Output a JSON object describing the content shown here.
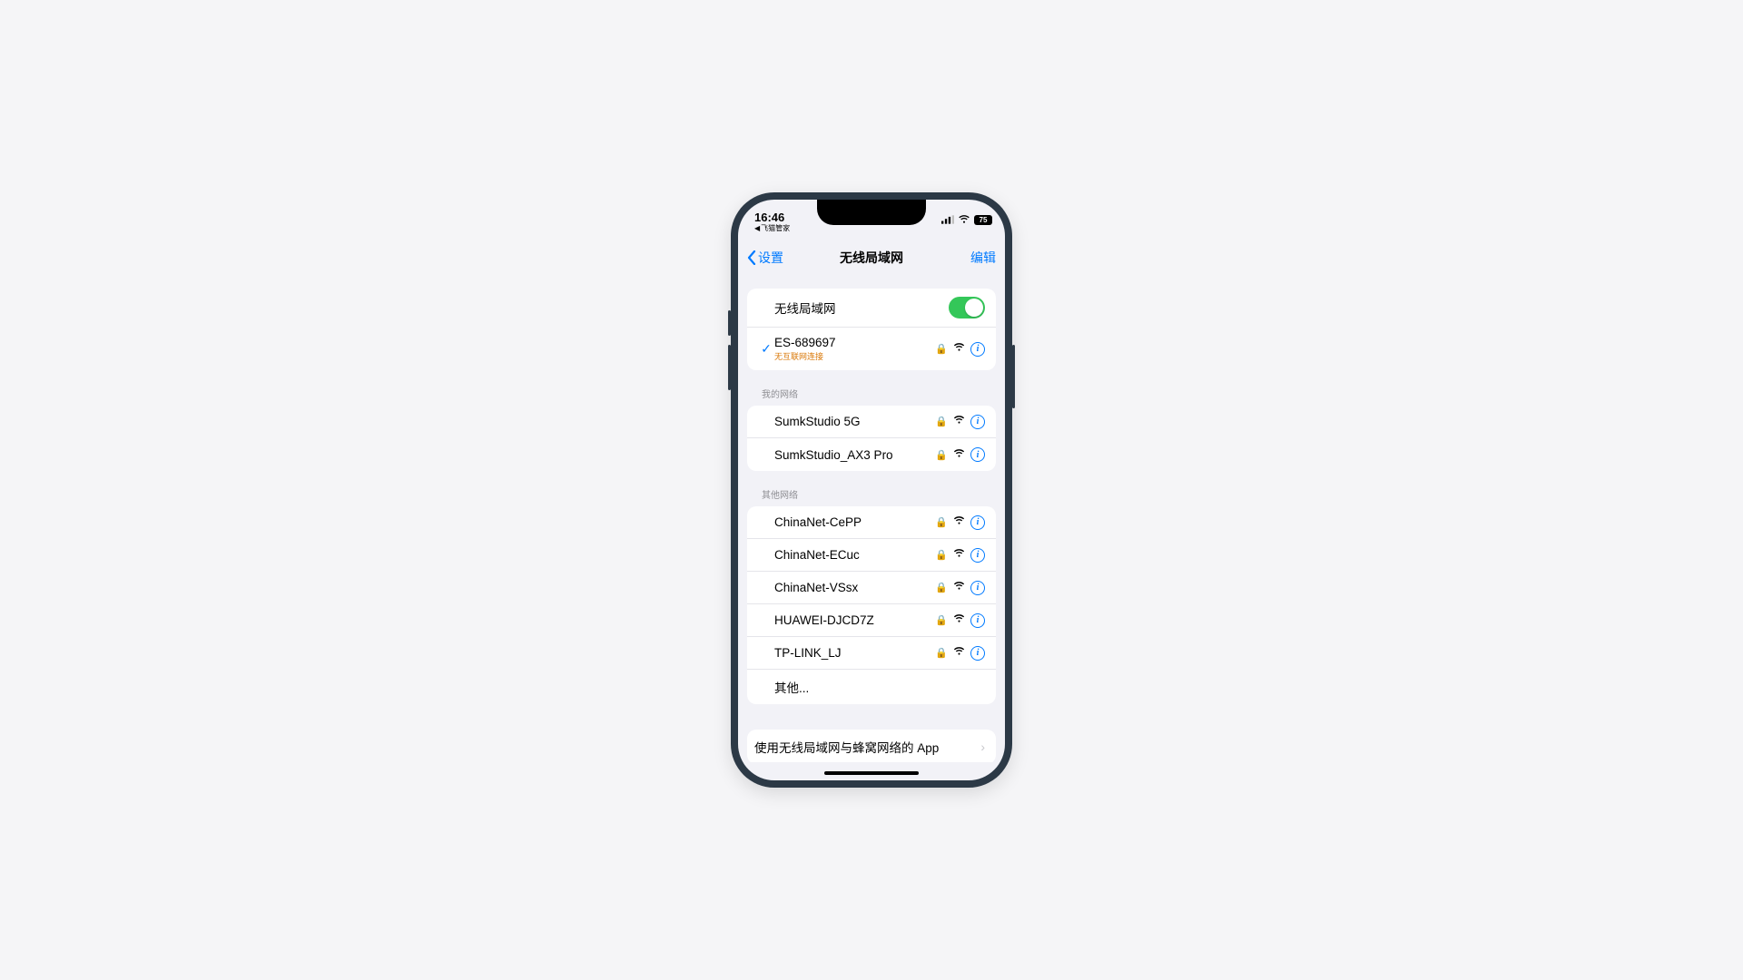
{
  "status": {
    "time": "16:46",
    "breadcrumb": "飞猫管家",
    "battery": "75"
  },
  "nav": {
    "back": "设置",
    "title": "无线局域网",
    "edit": "编辑"
  },
  "wlan": {
    "toggle_label": "无线局域网",
    "connected": {
      "name": "ES-689697",
      "status": "无互联网连接"
    }
  },
  "sections": {
    "my_header": "我的网络",
    "my_networks": [
      {
        "name": "SumkStudio 5G"
      },
      {
        "name": "SumkStudio_AX3 Pro"
      }
    ],
    "other_header": "其他网络",
    "other_networks": [
      {
        "name": "ChinaNet-CePP"
      },
      {
        "name": "ChinaNet-ECuc"
      },
      {
        "name": "ChinaNet-VSsx"
      },
      {
        "name": "HUAWEI-DJCD7Z"
      },
      {
        "name": "TP-LINK_LJ"
      }
    ],
    "other_manual": "其他..."
  },
  "footer": {
    "apps_label": "使用无线局域网与蜂窝网络的 App"
  }
}
